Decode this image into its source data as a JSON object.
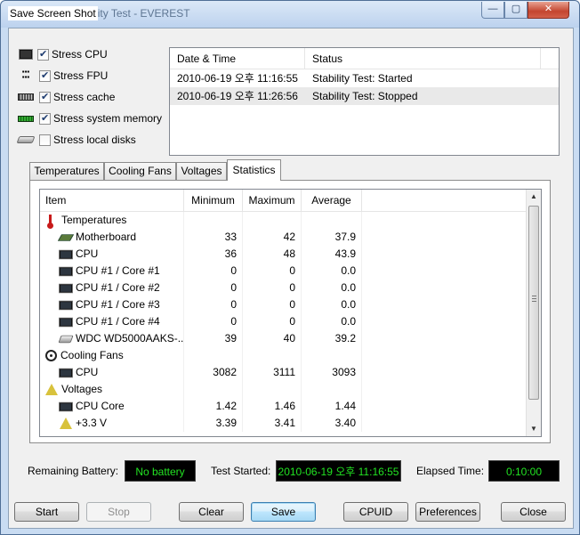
{
  "window": {
    "title_main": "Save Screen Shot",
    "title_ghost": "ity Test - EVEREST",
    "min_glyph": "—",
    "max_glyph": "▢",
    "close_glyph": "✕"
  },
  "stress_options": [
    {
      "label": "Stress CPU",
      "checked": true,
      "icon": "cpu-chip-icon"
    },
    {
      "label": "Stress FPU",
      "checked": true,
      "icon": "fpu-icon"
    },
    {
      "label": "Stress cache",
      "checked": true,
      "icon": "cache-chip-icon"
    },
    {
      "label": "Stress system memory",
      "checked": true,
      "icon": "memory-module-icon"
    },
    {
      "label": "Stress local disks",
      "checked": false,
      "icon": "hard-disk-icon"
    }
  ],
  "log": {
    "columns": [
      "Date & Time",
      "Status"
    ],
    "rows": [
      {
        "datetime": "2010-06-19 오후 11:16:55",
        "status": "Stability Test: Started"
      },
      {
        "datetime": "2010-06-19 오후 11:26:56",
        "status": "Stability Test: Stopped"
      }
    ]
  },
  "tabs": [
    "Temperatures",
    "Cooling Fans",
    "Voltages",
    "Statistics"
  ],
  "active_tab": "Statistics",
  "stats": {
    "columns": [
      "Item",
      "Minimum",
      "Maximum",
      "Average"
    ],
    "rows": [
      {
        "type": "group",
        "icon": "thermometer-icon",
        "item": "Temperatures",
        "min": "",
        "max": "",
        "avg": ""
      },
      {
        "type": "child",
        "icon": "motherboard-icon",
        "item": "Motherboard",
        "min": "33",
        "max": "42",
        "avg": "37.9"
      },
      {
        "type": "child",
        "icon": "cpu-icon",
        "item": "CPU",
        "min": "36",
        "max": "48",
        "avg": "43.9"
      },
      {
        "type": "child",
        "icon": "cpu-icon",
        "item": "CPU #1 / Core #1",
        "min": "0",
        "max": "0",
        "avg": "0.0"
      },
      {
        "type": "child",
        "icon": "cpu-icon",
        "item": "CPU #1 / Core #2",
        "min": "0",
        "max": "0",
        "avg": "0.0"
      },
      {
        "type": "child",
        "icon": "cpu-icon",
        "item": "CPU #1 / Core #3",
        "min": "0",
        "max": "0",
        "avg": "0.0"
      },
      {
        "type": "child",
        "icon": "cpu-icon",
        "item": "CPU #1 / Core #4",
        "min": "0",
        "max": "0",
        "avg": "0.0"
      },
      {
        "type": "child",
        "icon": "hard-disk-icon",
        "item": "WDC WD5000AAKS-...",
        "min": "39",
        "max": "40",
        "avg": "39.2"
      },
      {
        "type": "group",
        "icon": "fan-icon",
        "item": "Cooling Fans",
        "min": "",
        "max": "",
        "avg": ""
      },
      {
        "type": "child",
        "icon": "cpu-icon",
        "item": "CPU",
        "min": "3082",
        "max": "3111",
        "avg": "3093"
      },
      {
        "type": "group",
        "icon": "voltage-icon",
        "item": "Voltages",
        "min": "",
        "max": "",
        "avg": ""
      },
      {
        "type": "child",
        "icon": "cpu-icon",
        "item": "CPU Core",
        "min": "1.42",
        "max": "1.46",
        "avg": "1.44"
      },
      {
        "type": "child",
        "icon": "voltage-icon",
        "item": "+3.3 V",
        "min": "3.39",
        "max": "3.41",
        "avg": "3.40"
      }
    ]
  },
  "status": {
    "battery_label": "Remaining Battery:",
    "battery_value": "No battery",
    "started_label": "Test Started:",
    "started_value": "2010-06-19 오후 11:16:55",
    "elapsed_label": "Elapsed Time:",
    "elapsed_value": "0:10:00"
  },
  "buttons": {
    "start": "Start",
    "stop": "Stop",
    "clear": "Clear",
    "save": "Save",
    "cpuid": "CPUID",
    "preferences": "Preferences",
    "close": "Close"
  },
  "colors": {
    "lcd_text": "#22e322",
    "lcd_bg": "#000000",
    "selected_row": "#e9e9e9"
  }
}
